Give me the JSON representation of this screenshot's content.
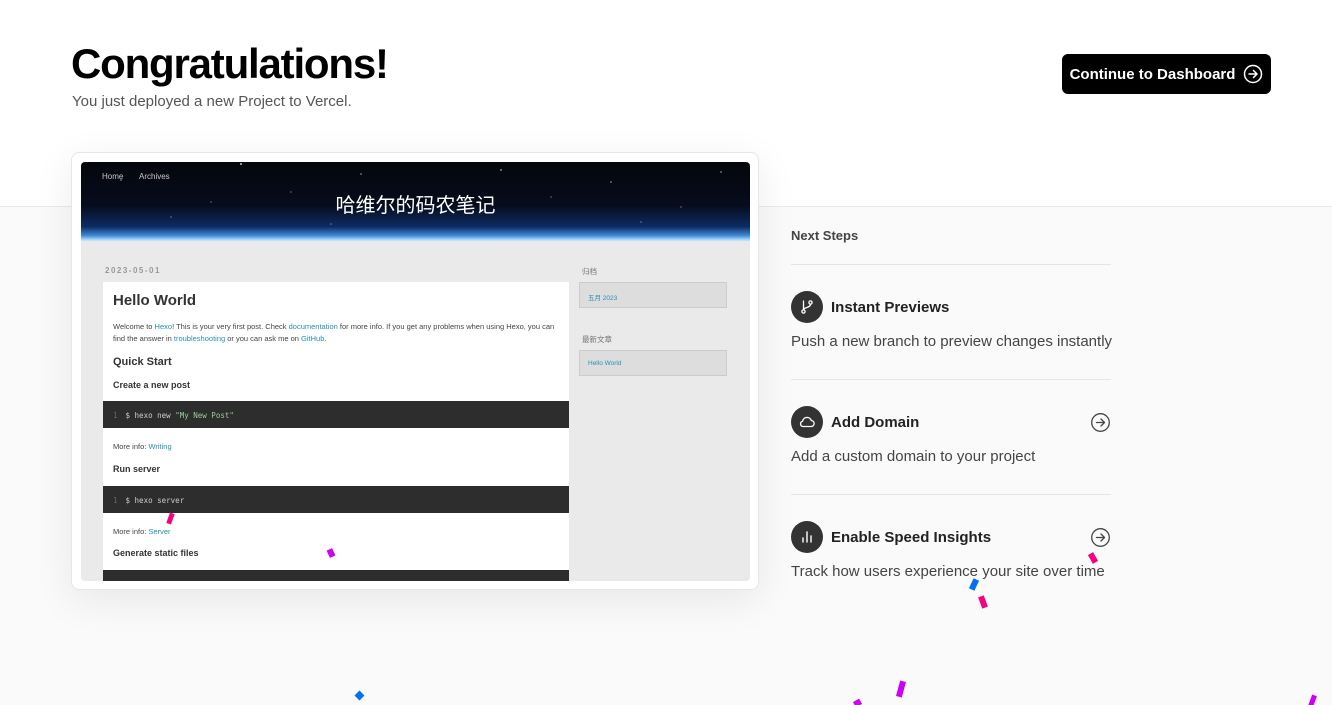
{
  "header": {
    "title": "Congratulations!",
    "subtitle": "You just deployed a new Project to Vercel.",
    "dashboard_button": "Continue to Dashboard"
  },
  "preview": {
    "nav": [
      "Home",
      "Archives"
    ],
    "site_title": "哈维尔的码农笔记",
    "post_date": "2023-05-01",
    "post_title": "Hello World",
    "intro": {
      "t1": "Welcome to ",
      "l1": "Hexo",
      "t2": "! This is your very first post. Check ",
      "l2": "documentation",
      "t3": " for more info. If you get any problems when using Hexo, you can find the answer in ",
      "l3": "troubleshooting",
      "t4": " or you can ask me on ",
      "l4": "GitHub",
      "t5": "."
    },
    "quick_start": "Quick Start",
    "create_post": "Create a new post",
    "code1_ln": "1",
    "code1_cmd": "$ hexo new ",
    "code1_str": "\"My New Post\"",
    "more_info": "More info: ",
    "more1_link": "Writing",
    "run_server": "Run server",
    "code2_ln": "1",
    "code2_cmd": "$ hexo server",
    "more2_link": "Server",
    "gen_static": "Generate static files",
    "sidebar_archive_h": "归档",
    "sidebar_archive_item": "五月 2023",
    "sidebar_recent_h": "最新文章",
    "sidebar_recent_item": "Hello World"
  },
  "next_steps": {
    "heading": "Next Steps",
    "items": [
      {
        "title": "Instant Previews",
        "desc": "Push a new branch to preview changes instantly",
        "icon": "git-branch-icon"
      },
      {
        "title": "Add Domain",
        "desc": "Add a custom domain to your project",
        "icon": "cloud-icon"
      },
      {
        "title": "Enable Speed Insights",
        "desc": "Track how users experience your site over time",
        "icon": "bar-chart-icon"
      }
    ]
  },
  "colors": {
    "accent": "#000000",
    "link": "#258fb8",
    "confetti_pink": "#f0047f",
    "confetti_blue": "#0070f3",
    "confetti_purple": "#cd00f5"
  }
}
